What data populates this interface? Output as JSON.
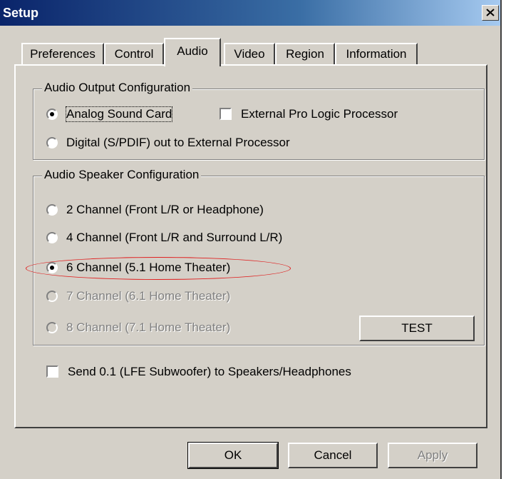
{
  "window": {
    "title": "Setup",
    "close_label": "close"
  },
  "tabs": [
    {
      "label": "Preferences",
      "active": false
    },
    {
      "label": "Control",
      "active": false
    },
    {
      "label": "Audio",
      "active": true
    },
    {
      "label": "Video",
      "active": false
    },
    {
      "label": "Region",
      "active": false
    },
    {
      "label": "Information",
      "active": false
    }
  ],
  "output_group": {
    "title": "Audio Output Configuration",
    "analog": {
      "label": "Analog Sound Card",
      "selected": true
    },
    "external_pro_logic": {
      "label": "External Pro Logic Processor",
      "checked": false
    },
    "digital": {
      "label": "Digital (S/PDIF) out to External Processor",
      "selected": false
    }
  },
  "speaker_group": {
    "title": "Audio Speaker Configuration",
    "options": [
      {
        "label": "2 Channel (Front L/R or Headphone)",
        "selected": false,
        "enabled": true
      },
      {
        "label": "4 Channel (Front L/R and Surround L/R)",
        "selected": false,
        "enabled": true
      },
      {
        "label": "6 Channel (5.1 Home Theater)",
        "selected": true,
        "enabled": true
      },
      {
        "label": "7 Channel (6.1 Home Theater)",
        "selected": false,
        "enabled": false
      },
      {
        "label": "8 Channel (7.1 Home Theater)",
        "selected": false,
        "enabled": false
      }
    ],
    "test_label": "TEST"
  },
  "lfe": {
    "label": "Send 0.1 (LFE Subwoofer) to Speakers/Headphones",
    "checked": false
  },
  "buttons": {
    "ok": "OK",
    "cancel": "Cancel",
    "apply": "Apply"
  },
  "colors": {
    "highlight": "#e02020",
    "titlebar": "#0a246a"
  }
}
